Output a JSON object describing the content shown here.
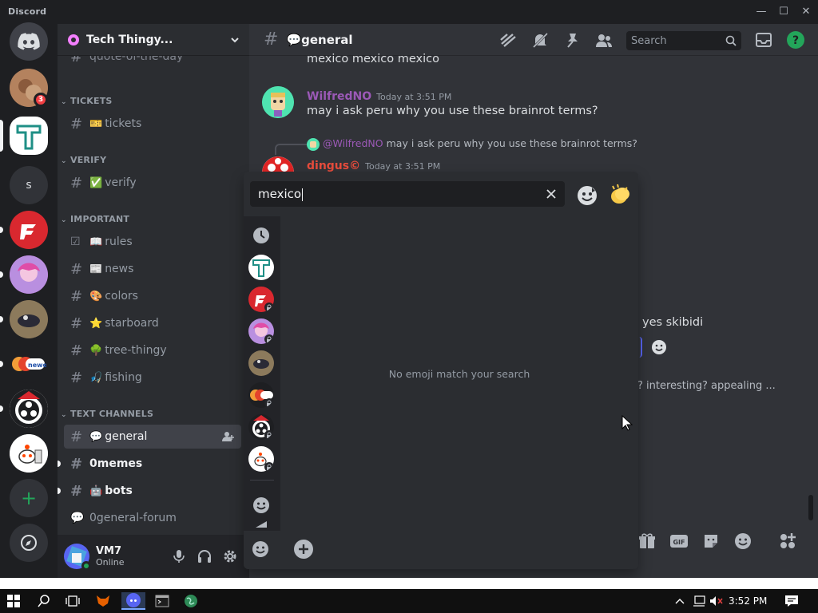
{
  "window": {
    "app_name": "Discord",
    "controls": [
      "—",
      "☐",
      "✕"
    ]
  },
  "colors": {
    "blurple": "#5865f2",
    "online": "#23a55a",
    "danger": "#f23f43",
    "link_green": "#23a55a"
  },
  "guilds": {
    "items": [
      {
        "name": "home",
        "badge": ""
      },
      {
        "name": "cat-server",
        "badge": "3"
      },
      {
        "name": "tech-thingy",
        "badge": ""
      },
      {
        "name": "s-server",
        "label": "s"
      },
      {
        "name": "red-server"
      },
      {
        "name": "anime-server"
      },
      {
        "name": "bird-server"
      },
      {
        "name": "newo-server"
      },
      {
        "name": "obs-server"
      },
      {
        "name": "reddit-server"
      }
    ]
  },
  "server": {
    "name": "Tech Thingy..."
  },
  "sidebar": {
    "cut_channel": "quote-of-the-day",
    "categories": [
      {
        "label": "TICKETS"
      },
      {
        "label": "VERIFY"
      },
      {
        "label": "IMPORTANT"
      },
      {
        "label": "TEXT CHANNELS"
      }
    ],
    "channels": [
      {
        "label": "tickets",
        "emoji": "🎫"
      },
      {
        "label": "verify",
        "emoji": "✅"
      },
      {
        "label": "rules",
        "emoji": "📖"
      },
      {
        "label": "news",
        "emoji": "📰"
      },
      {
        "label": "colors",
        "emoji": "🎨"
      },
      {
        "label": "starboard",
        "emoji": "⭐"
      },
      {
        "label": "tree-thingy",
        "emoji": "🌳"
      },
      {
        "label": "fishing",
        "emoji": "🎣"
      },
      {
        "label": "general",
        "emoji": "💬"
      },
      {
        "label": "0memes"
      },
      {
        "label": "bots",
        "emoji": "🤖"
      },
      {
        "label": "0general-forum"
      }
    ]
  },
  "user": {
    "name": "VM7",
    "status": "Online"
  },
  "channel": {
    "name": "general",
    "emoji": "💬"
  },
  "header": {
    "search_placeholder": "Search"
  },
  "messages": {
    "top_text": "mexico mexico mexico",
    "m1": {
      "author": "WilfredNO",
      "time": "Today at 3:51 PM",
      "text": "may i ask peru why you use these brainrot terms?"
    },
    "m2": {
      "reply_author": "@WilfredNO",
      "reply_text": "may i ask peru why you use these brainrot terms?",
      "author": "dingus©",
      "time": "Today at 3:51 PM"
    },
    "visible_right": "yes skibidi",
    "visible_right2": "? interesting? appealing ..."
  },
  "picker": {
    "query": "mexico",
    "empty_text": "No emoji match your search"
  },
  "taskbar": {
    "time": "3:52 PM"
  }
}
